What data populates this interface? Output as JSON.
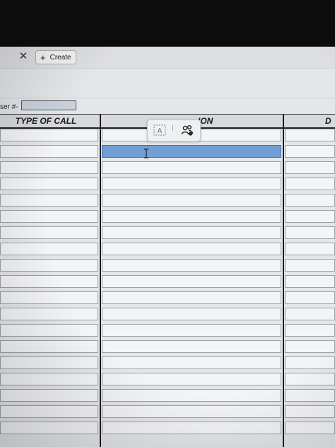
{
  "toolbar": {
    "close_glyph": "✕",
    "create_label": "Create",
    "create_icon": "plus-icon"
  },
  "form": {
    "user_label": "ser #-",
    "user_value": ""
  },
  "table": {
    "headers": [
      "TYPE OF CALL",
      "ION",
      "D"
    ],
    "row_count": 19,
    "active_row_index": 1,
    "active_column": "location",
    "accent_color": "#6f9fd3"
  },
  "popup": {
    "text_icon": "text-box-icon",
    "people_icon": "people-icon",
    "text_glyph": "A"
  }
}
